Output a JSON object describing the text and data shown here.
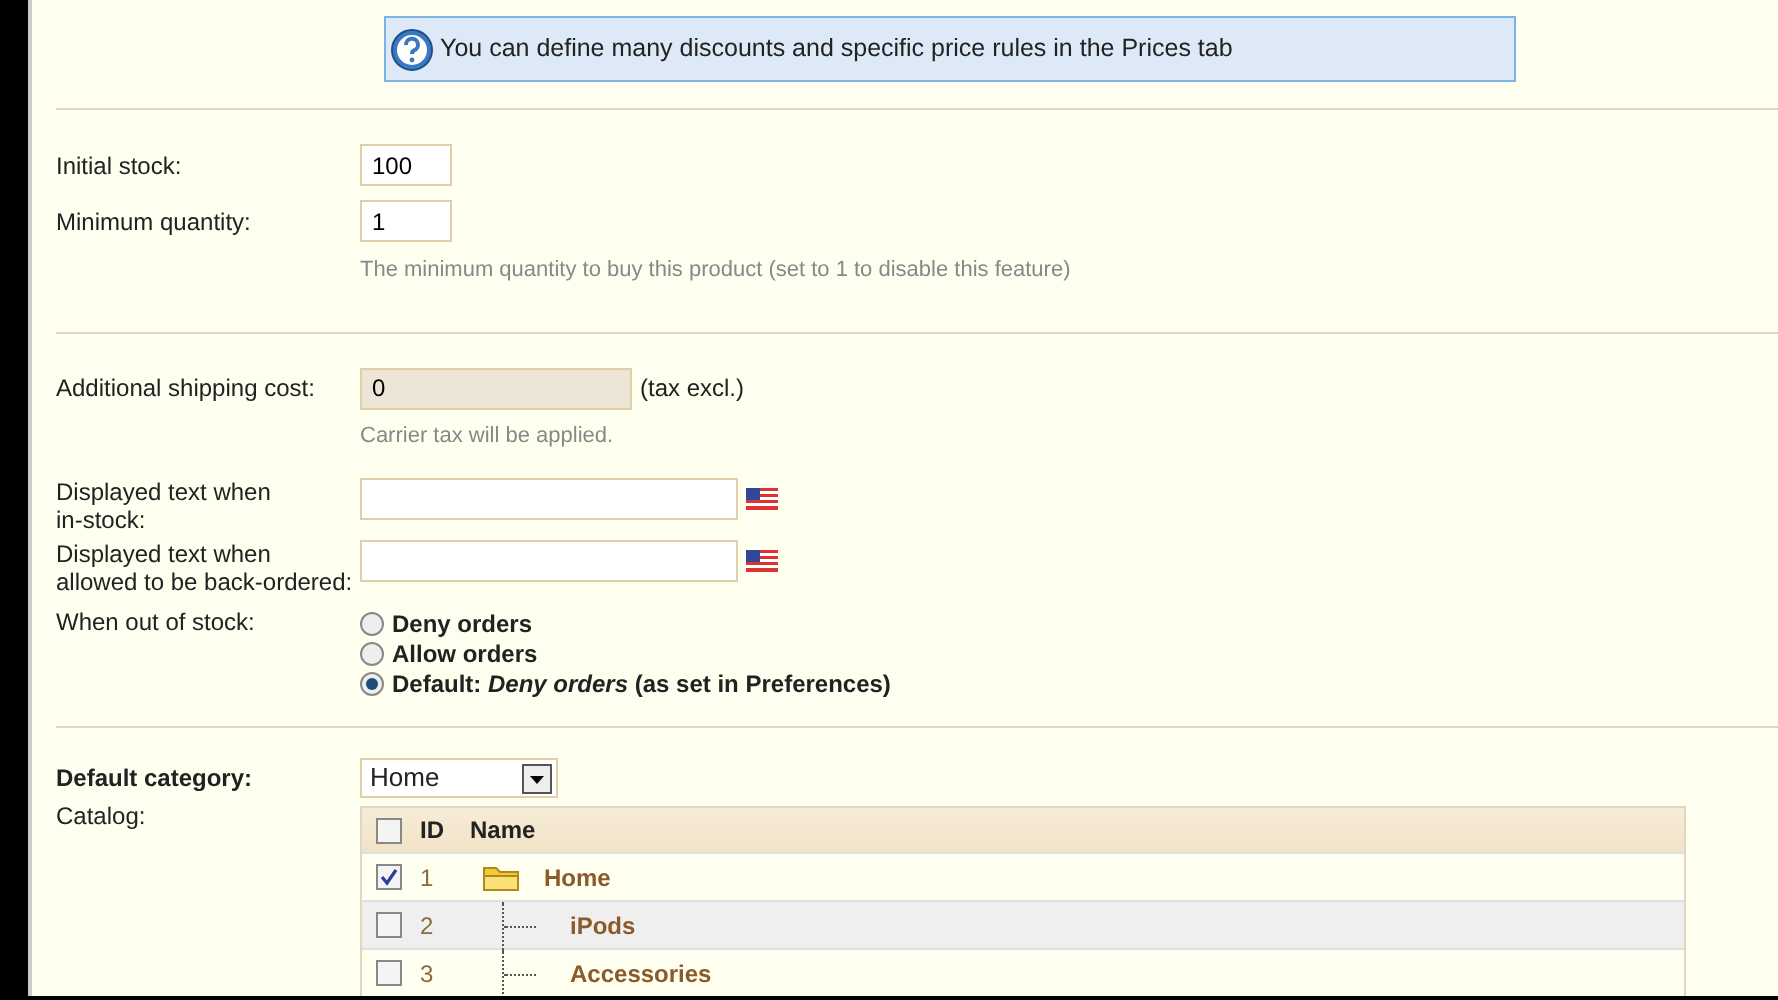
{
  "info_box": {
    "text": "You can define many discounts and specific price rules in the Prices tab"
  },
  "stock": [
    {
      "label": "Initial stock:",
      "value": "100"
    },
    {
      "label": "Minimum quantity:",
      "value": "1",
      "hint": "The minimum quantity to buy this product (set to 1 to disable this feature)"
    }
  ],
  "shipping": {
    "label": "Additional shipping cost:",
    "value": "0",
    "suffix": "(tax excl.)",
    "hint": "Carrier tax will be applied."
  },
  "texts": [
    {
      "label": "Displayed text when\nin-stock:"
    },
    {
      "label": "Displayed text when\nallowed to be back-ordered:"
    }
  ],
  "out_of_stock": {
    "label": "When out of stock:",
    "options": [
      {
        "text": "Deny orders",
        "selected": false
      },
      {
        "text": "Allow orders",
        "selected": false
      },
      {
        "text": "Default: *Deny orders* (as set in Preferences)",
        "selected": true
      }
    ]
  },
  "default_category": {
    "label": "Default category:",
    "value": "Home"
  },
  "catalog": {
    "label": "Catalog:",
    "columns": [
      "ID",
      "Name"
    ],
    "header_checked": false,
    "rows": [
      {
        "id": "1",
        "name": "Home",
        "checked": true,
        "children": [
          {
            "id": "2",
            "name": "iPods",
            "checked": false
          },
          {
            "id": "3",
            "name": "Accessories",
            "checked": false
          }
        ]
      }
    ]
  }
}
